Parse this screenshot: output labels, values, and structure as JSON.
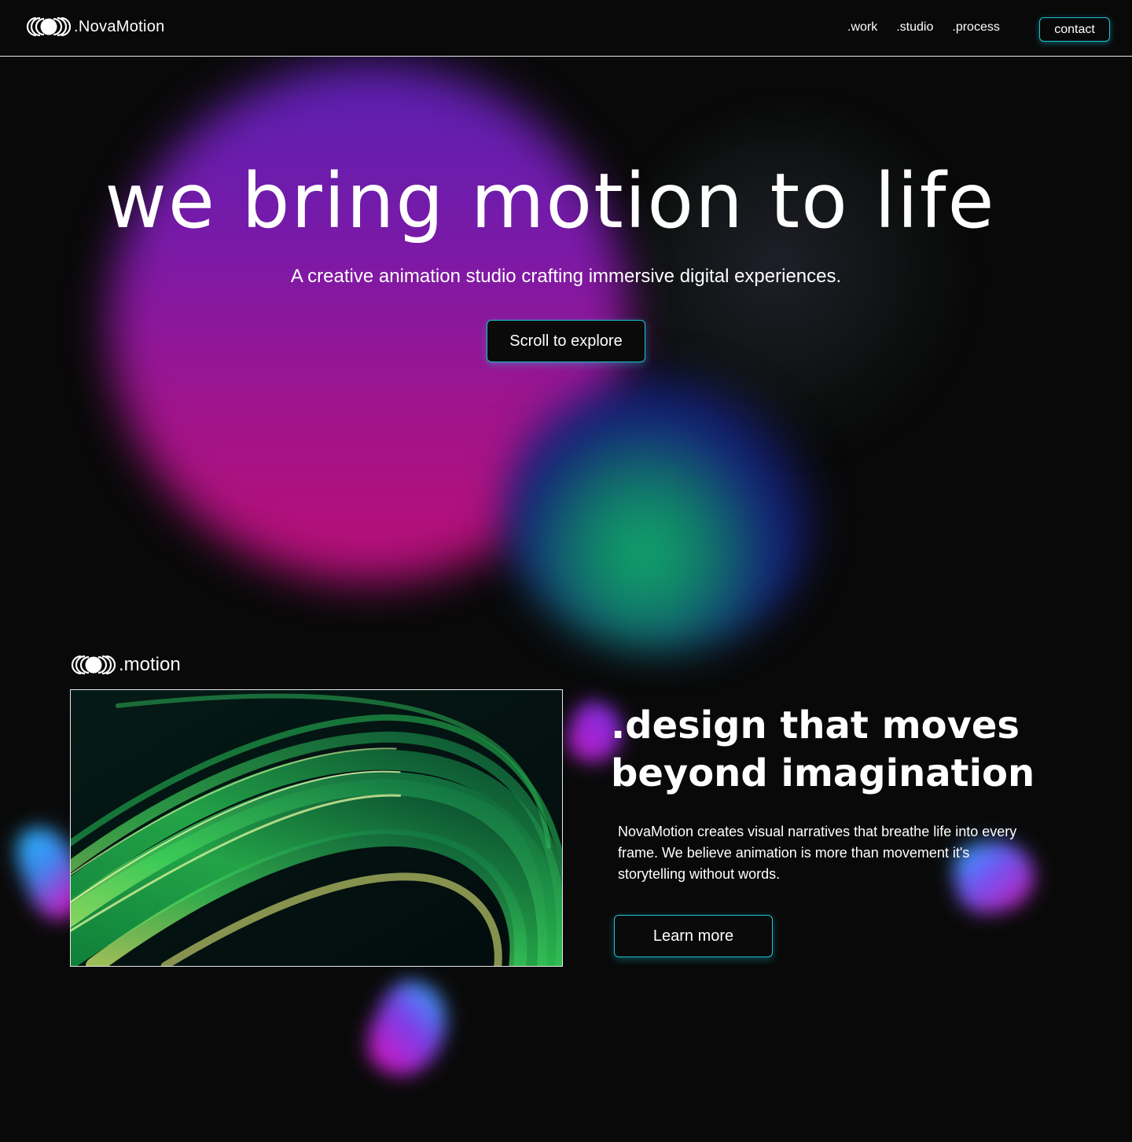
{
  "header": {
    "brand_name": ".NovaMotion",
    "nav": [
      ".work",
      ".studio",
      ".process"
    ],
    "contact_label": "contact"
  },
  "hero": {
    "title": "we bring motion to life",
    "subtitle": "A creative animation studio crafting immersive digital experiences.",
    "cta_label": "Scroll to explore"
  },
  "section": {
    "brand_name": ".motion",
    "title_line1": ".design that moves",
    "title_line2": "beyond imagination",
    "body": "NovaMotion creates visual narratives that breathe life into every frame. We believe animation is more than movement it's storytelling without words.",
    "cta_label": "Learn more"
  },
  "colors": {
    "background": "#090909",
    "accent": "#1ec3d4",
    "text": "#ffffff",
    "blob_purple": "#7a1aa8",
    "blob_magenta": "#b3107a",
    "blob_green": "#10a868"
  },
  "icons": {
    "logo": "concentric-circles-logo-icon"
  }
}
